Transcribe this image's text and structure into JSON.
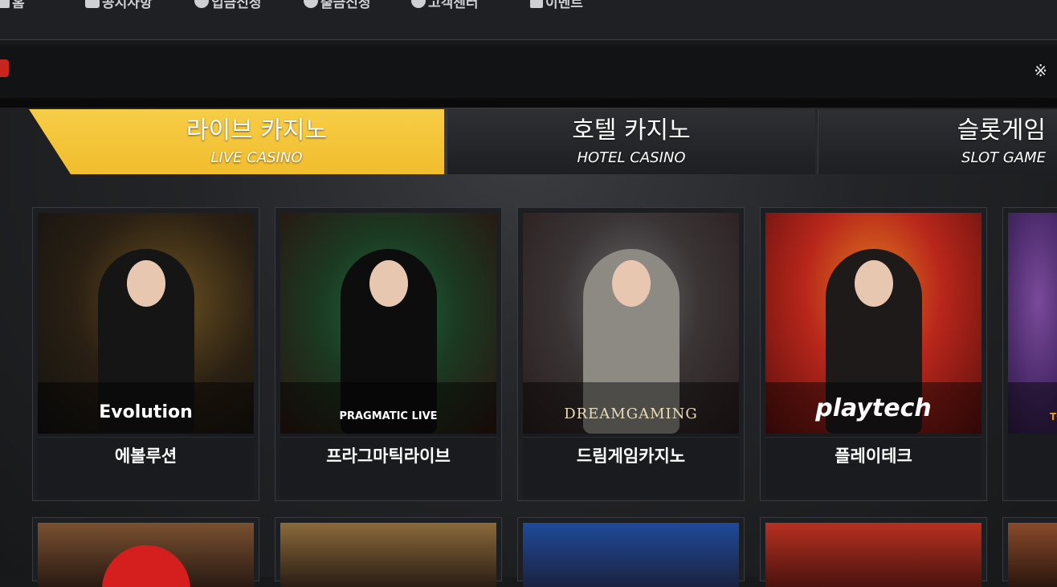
{
  "nav": {
    "items": [
      {
        "label": "홈",
        "icon": "home-icon"
      },
      {
        "label": "공지사항",
        "icon": "bell-icon"
      },
      {
        "label": "입금신청",
        "icon": "coin-icon"
      },
      {
        "label": "출금신청",
        "icon": "coin-icon"
      },
      {
        "label": "고객센터",
        "icon": "chat-icon"
      },
      {
        "label": "이벤트",
        "icon": "gift-icon"
      }
    ]
  },
  "notice": {
    "close_glyph": "※"
  },
  "tabs": [
    {
      "ko": "라이브 카지노",
      "en": "LIVE CASINO",
      "active": true
    },
    {
      "ko": "호텔 카지노",
      "en": "HOTEL CASINO",
      "active": false
    },
    {
      "ko": "슬롯게임",
      "en": "SLOT GAME",
      "active": false
    }
  ],
  "games": [
    {
      "name": "에볼루션",
      "logo": "Evolution"
    },
    {
      "name": "프라그마틱라이브",
      "logo": "PRAGMATIC LIVE"
    },
    {
      "name": "드림게임카지노",
      "logo": "DREAMGAMING"
    },
    {
      "name": "플레이테크",
      "logo": "playtech"
    },
    {
      "name": "",
      "logo": "TG"
    }
  ],
  "colors": {
    "accent": "#f4c43a",
    "background": "#18191b",
    "badge": "#c6261d"
  }
}
